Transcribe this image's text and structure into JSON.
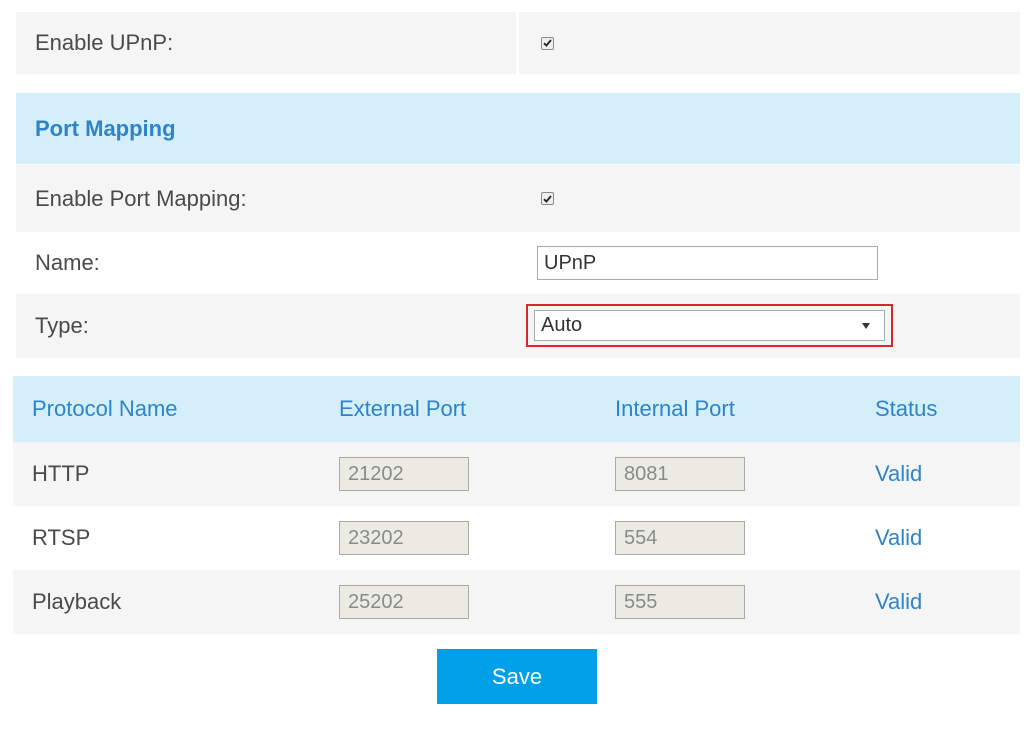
{
  "upnp": {
    "enable_label": "Enable UPnP:",
    "enabled": true
  },
  "port_mapping": {
    "section_title": "Port Mapping",
    "enable_label": "Enable Port Mapping:",
    "enabled": true,
    "name_label": "Name:",
    "name_value": "UPnP",
    "type_label": "Type:",
    "type_value": "Auto"
  },
  "table": {
    "headers": [
      "Protocol Name",
      "External Port",
      "Internal Port",
      "Status"
    ],
    "rows": [
      {
        "protocol": "HTTP",
        "external_port": "21202",
        "internal_port": "8081",
        "status": "Valid"
      },
      {
        "protocol": "RTSP",
        "external_port": "23202",
        "internal_port": "554",
        "status": "Valid"
      },
      {
        "protocol": "Playback",
        "external_port": "25202",
        "internal_port": "555",
        "status": "Valid"
      }
    ]
  },
  "actions": {
    "save_label": "Save"
  },
  "colors": {
    "accent": "#2e84c7",
    "header_bg": "#d4eefa",
    "button_bg": "#00a0e9",
    "highlight": "#d9252c"
  }
}
